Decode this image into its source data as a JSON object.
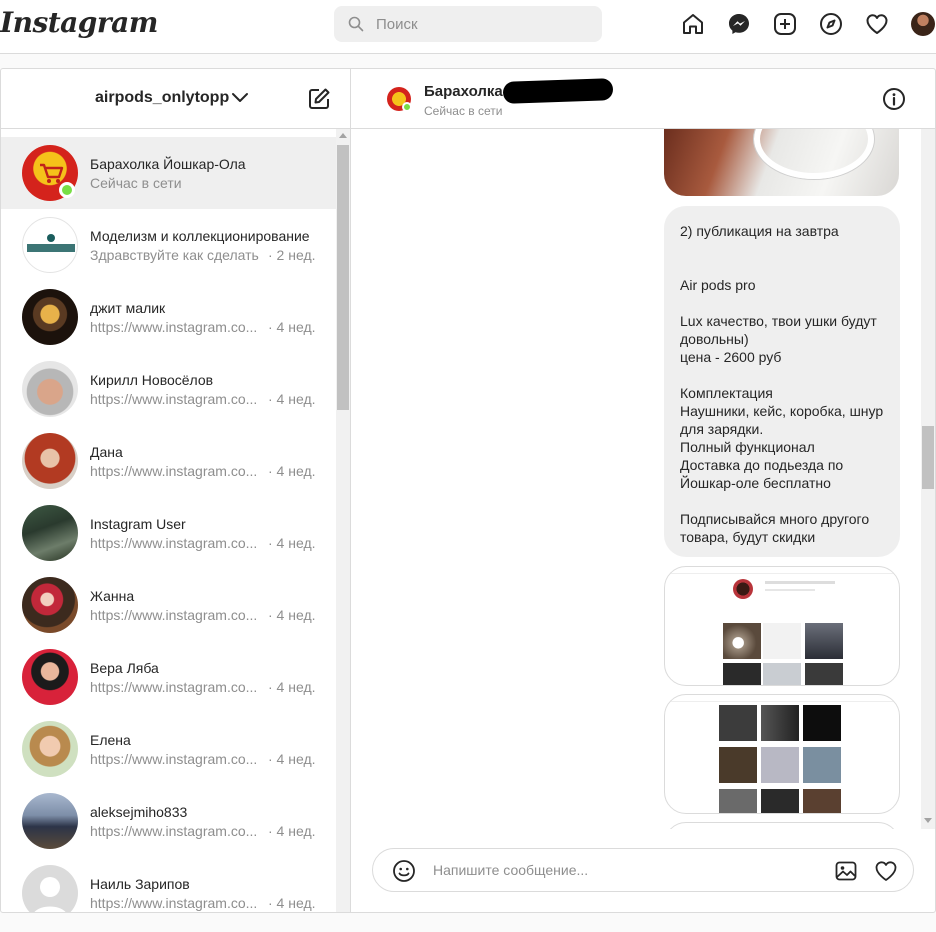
{
  "nav": {
    "logo": "Instagram",
    "search_placeholder": "Поиск",
    "icons": [
      "home-icon",
      "messenger-icon",
      "new-post-icon",
      "explore-icon",
      "activity-heart-icon",
      "profile-avatar"
    ]
  },
  "inbox": {
    "account": "airpods_onlytopp",
    "threads": [
      {
        "name": "Барахолка Йошкар-Ола",
        "sub": "Сейчас в сети",
        "time": "",
        "active": true,
        "online": true
      },
      {
        "name": "Моделизм и коллекционирование",
        "sub": "Здравствуйте как сделать...",
        "time": "· 2 нед.",
        "active": false,
        "online": false
      },
      {
        "name": "джит малик",
        "sub": "https://www.instagram.co...",
        "time": "· 4 нед.",
        "active": false,
        "online": false
      },
      {
        "name": "Кирилл Новосёлов",
        "sub": "https://www.instagram.co...",
        "time": "· 4 нед.",
        "active": false,
        "online": false
      },
      {
        "name": "Дана",
        "sub": "https://www.instagram.co...",
        "time": "· 4 нед.",
        "active": false,
        "online": false
      },
      {
        "name": "Instagram User",
        "sub": "https://www.instagram.co...",
        "time": "· 4 нед.",
        "active": false,
        "online": false
      },
      {
        "name": "Жанна",
        "sub": "https://www.instagram.co...",
        "time": "· 4 нед.",
        "active": false,
        "online": false
      },
      {
        "name": "Вера Ляба",
        "sub": "https://www.instagram.co...",
        "time": "· 4 нед.",
        "active": false,
        "online": false
      },
      {
        "name": "Елена",
        "sub": "https://www.instagram.co...",
        "time": "· 4 нед.",
        "active": false,
        "online": false
      },
      {
        "name": "aleksejmiho833",
        "sub": "https://www.instagram.co...",
        "time": "· 4 нед.",
        "active": false,
        "online": false
      },
      {
        "name": "Наиль Зарипов",
        "sub": "https://www.instagram.co...",
        "time": "· 4 нед.",
        "active": false,
        "online": false
      }
    ]
  },
  "chat": {
    "title": "Барахолка",
    "status": "Сейчас в сети",
    "message_text": "2) публикация на завтра\n\n\nAir pods pro\n\nLux качество, твои ушки будут довольны)\nцена - 2600 руб\n\nКомплектация\nНаушники, кейс, коробка, шнур для зарядки.\nПолный функционал\nДоставка до подьезда по Йошкар-оле бесплатно\n\nПодписывайся много другого товара, будут скидки",
    "composer_placeholder": "Напишите сообщение..."
  },
  "colors": {
    "border": "#dbdbdb",
    "muted_text": "#8e8e8e",
    "online": "#78de45",
    "active_row": "#efefef"
  }
}
